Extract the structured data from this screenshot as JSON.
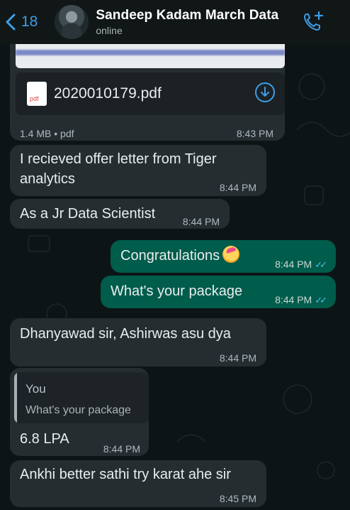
{
  "header": {
    "back_count": "18",
    "contact_name": "Sandeep Kadam March Data",
    "status": "online"
  },
  "messages": {
    "file": {
      "file_name": "2020010179.pdf",
      "file_type_icon": "pdf",
      "meta": "1.4 MB • pdf",
      "time": "8:43 PM"
    },
    "m1": {
      "text": "I recieved offer letter from Tiger analytics",
      "time": "8:44 PM"
    },
    "m2": {
      "text": "As a Jr Data Scientist",
      "time": "8:44 PM"
    },
    "m3": {
      "text": "Congratulations",
      "time": "8:44 PM"
    },
    "m4": {
      "text": "What's your package",
      "time": "8:44 PM"
    },
    "m5": {
      "text": "Dhanyawad sir, Ashirwas asu dya",
      "time": "8:44 PM"
    },
    "m6": {
      "quote_author": "You",
      "quote_text": "What's your package",
      "text": "6.8 LPA",
      "time": "8:44 PM"
    },
    "m7": {
      "text": "Ankhi better sathi try karat ahe sir",
      "time": "8:45 PM"
    }
  },
  "colors": {
    "accent": "#3d9ee8",
    "incoming_bubble": "#262d31",
    "outgoing_bubble": "#005c4b",
    "read_ticks": "#53bdeb"
  }
}
